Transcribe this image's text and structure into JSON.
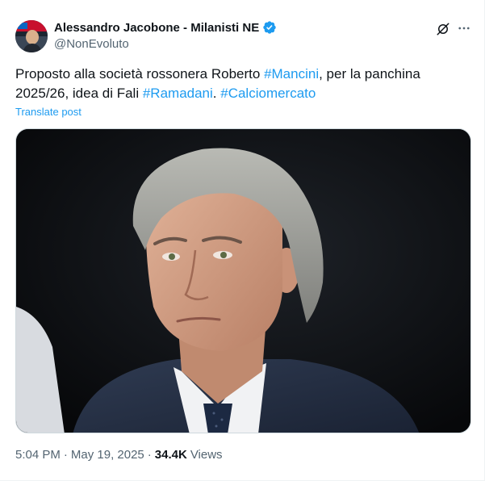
{
  "author": {
    "display_name": "Alessandro Jacobone - Milanisti NE",
    "handle": "@NonEvoluto",
    "verified_icon": "verified-badge-icon",
    "avatar_icon": "avatar"
  },
  "actions": {
    "grok_icon": "grok-icon",
    "more_icon": "more-icon"
  },
  "text": {
    "part1": "Proposto alla società rossonera  Roberto ",
    "tag1": "#Mancini",
    "part2": ", per la panchina 2025/26, idea di Fali ",
    "tag2": "#Ramadani",
    "part3": ". ",
    "tag3": "#Calciomercato"
  },
  "translate_label": "Translate post",
  "footer": {
    "time": "5:04 PM",
    "sep1": "·",
    "date": "May 19, 2025",
    "sep2": "·",
    "views_count": "34.4K",
    "views_label": "Views"
  },
  "colors": {
    "link": "#1d9bf0",
    "text": "#0f1419",
    "secondary": "#536471",
    "verified": "#1d9bf0"
  }
}
